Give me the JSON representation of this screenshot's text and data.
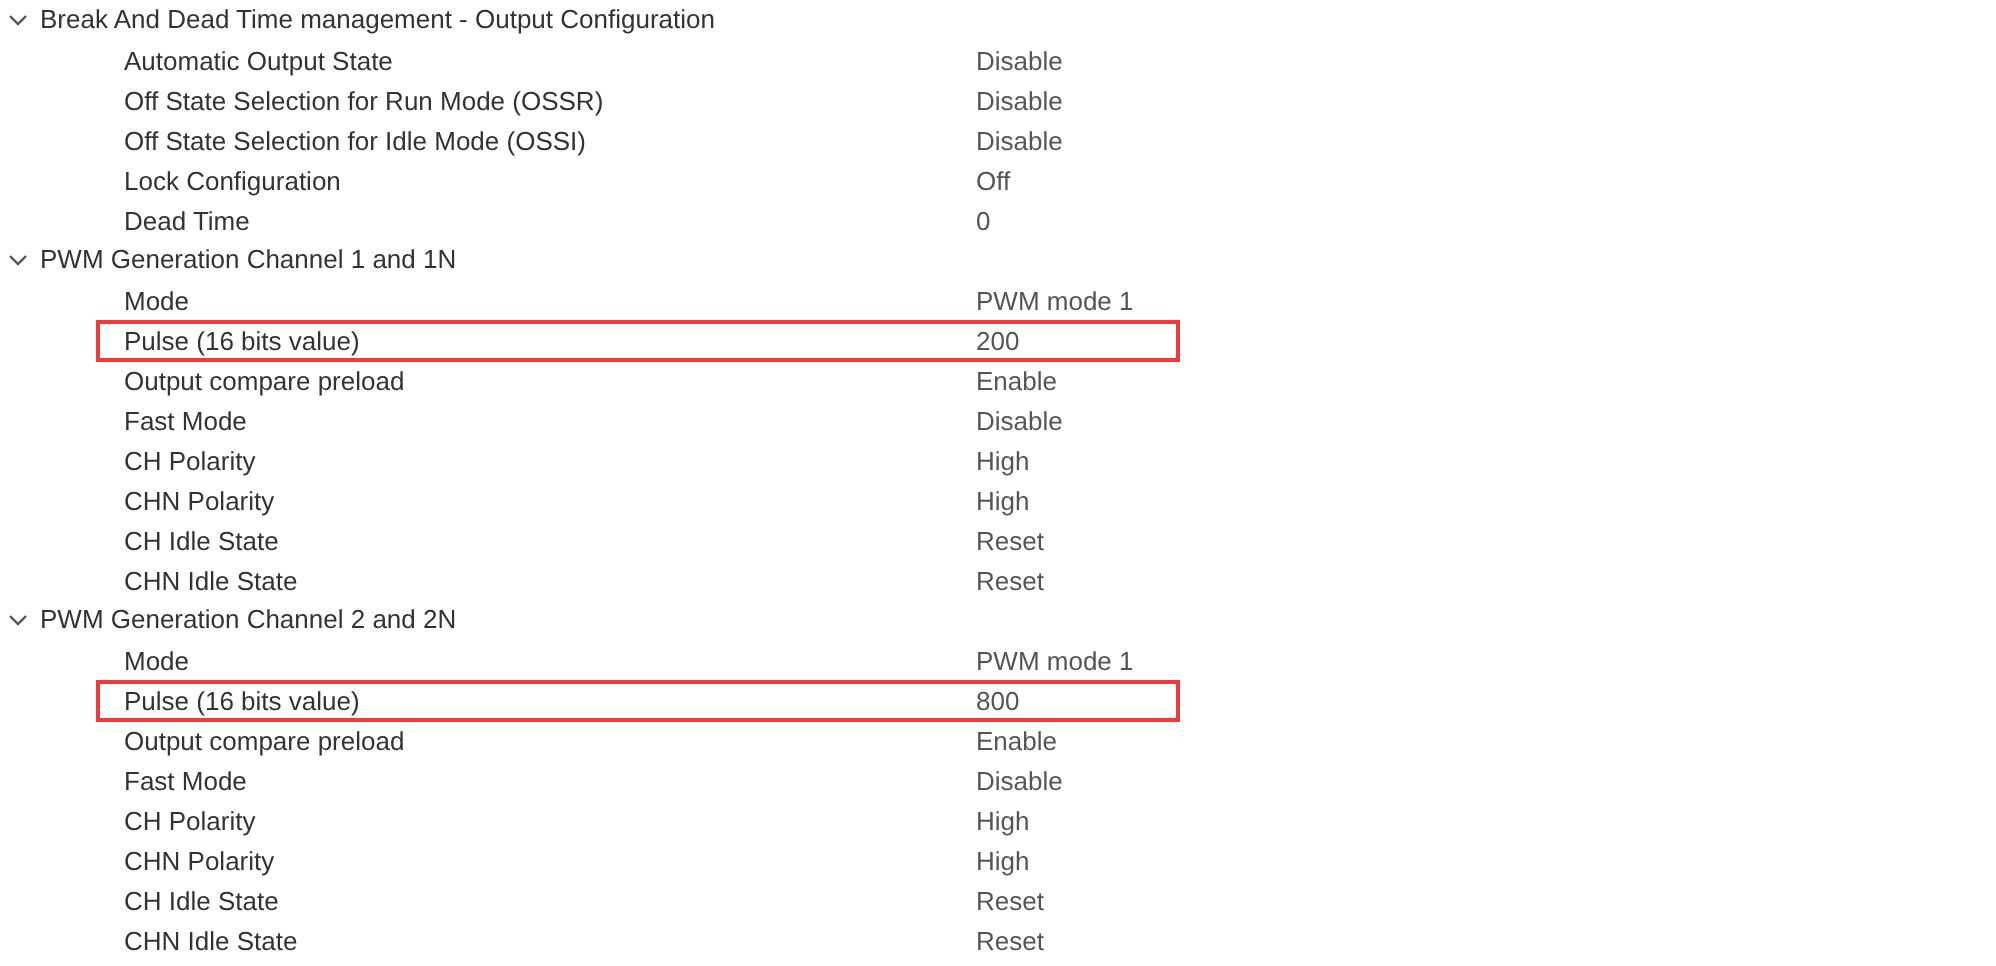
{
  "groups": [
    {
      "label": "Break And Dead Time management - Output Configuration",
      "expanded": true,
      "children": [
        {
          "label": "Automatic Output State",
          "value": "Disable",
          "highlighted": false
        },
        {
          "label": "Off State Selection for Run Mode (OSSR)",
          "value": "Disable",
          "highlighted": false
        },
        {
          "label": "Off State Selection for Idle Mode (OSSI)",
          "value": "Disable",
          "highlighted": false
        },
        {
          "label": "Lock Configuration",
          "value": "Off",
          "highlighted": false
        },
        {
          "label": "Dead Time",
          "value": "0",
          "highlighted": false
        }
      ]
    },
    {
      "label": "PWM Generation Channel 1 and 1N",
      "expanded": true,
      "children": [
        {
          "label": "Mode",
          "value": "PWM mode 1",
          "highlighted": false
        },
        {
          "label": "Pulse (16 bits value)",
          "value": "200",
          "highlighted": true
        },
        {
          "label": "Output compare preload",
          "value": "Enable",
          "highlighted": false
        },
        {
          "label": "Fast Mode",
          "value": "Disable",
          "highlighted": false
        },
        {
          "label": "CH Polarity",
          "value": "High",
          "highlighted": false
        },
        {
          "label": "CHN Polarity",
          "value": "High",
          "highlighted": false
        },
        {
          "label": "CH Idle State",
          "value": "Reset",
          "highlighted": false
        },
        {
          "label": "CHN Idle State",
          "value": "Reset",
          "highlighted": false
        }
      ]
    },
    {
      "label": "PWM Generation Channel 2 and 2N",
      "expanded": true,
      "children": [
        {
          "label": "Mode",
          "value": "PWM mode 1",
          "highlighted": false
        },
        {
          "label": "Pulse (16 bits value)",
          "value": "800",
          "highlighted": true
        },
        {
          "label": "Output compare preload",
          "value": "Enable",
          "highlighted": false
        },
        {
          "label": "Fast Mode",
          "value": "Disable",
          "highlighted": false
        },
        {
          "label": "CH Polarity",
          "value": "High",
          "highlighted": false
        },
        {
          "label": "CHN Polarity",
          "value": "High",
          "highlighted": false
        },
        {
          "label": "CH Idle State",
          "value": "Reset",
          "highlighted": false
        },
        {
          "label": "CHN Idle State",
          "value": "Reset",
          "highlighted": false
        }
      ]
    }
  ]
}
